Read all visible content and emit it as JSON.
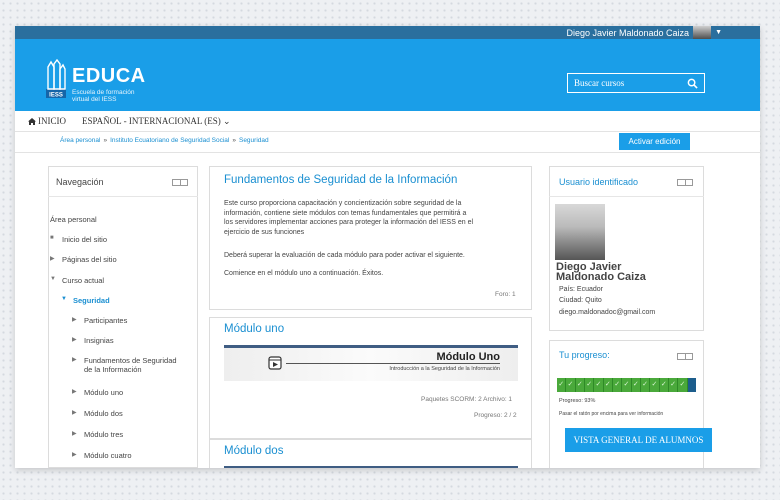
{
  "topbar": {
    "user_name": "Diego Javier Maldonado Caiza"
  },
  "header": {
    "logo_title": "EDUCA",
    "logo_subtitle_1": "Escuela de formación",
    "logo_subtitle_2": "virtual del IESS",
    "logo_mark_text": "IESS",
    "search_placeholder": "Buscar cursos"
  },
  "nav": {
    "home": "INICIO",
    "language": "ESPAÑOL - INTERNACIONAL (ES)"
  },
  "breadcrumb": [
    "Área personal",
    "Instituto Ecuatoriano de Seguridad Social",
    "Seguridad"
  ],
  "breadcrumb_separator": "»",
  "edit_button": "Activar edición",
  "navigation_block": {
    "title": "Navegación",
    "items": [
      "Área personal",
      "Inicio del sitio",
      "Páginas del sitio",
      "Curso actual",
      "Seguridad",
      "Participantes",
      "Insignias",
      "Fundamentos de Seguridad",
      "de la Información",
      "Módulo uno",
      "Módulo dos",
      "Módulo tres",
      "Módulo cuatro"
    ]
  },
  "course": {
    "title": "Fundamentos de Seguridad de la Información",
    "description_lines": [
      "Este curso proporciona capacitación y concientización sobre seguridad de la",
      "información, contiene siete módulos con temas fundamentales que permitirá a",
      "los servidores implementar acciones para proteger la información del IESS en el",
      "ejercicio de sus funciones"
    ],
    "instruction": "Deberá superar la evaluación de cada módulo para poder activar el siguiente.",
    "start_note": "Comience en el módulo uno a continuación. Éxitos.",
    "forum_link": "Foro: 1"
  },
  "module_one": {
    "title": "Módulo uno",
    "banner_title": "Módulo Uno",
    "banner_subtitle": "Introducción a la Seguridad de la Información",
    "meta": "Paquetes SCORM: 2  Archivo: 1",
    "progress": "Progreso: 2 / 2"
  },
  "module_two": {
    "title": "Módulo dos"
  },
  "user_block": {
    "title": "Usuario identificado",
    "name_line1": "Diego Javier",
    "name_line2": "Maldonado Caiza",
    "country": "País: Ecuador",
    "city": "Ciudad: Quito",
    "email": "diego.maldonadoc@gmail.com"
  },
  "progress_block": {
    "title": "Tu progreso:",
    "checks": [
      "✓",
      "✓",
      "✓",
      "✓",
      "✓",
      "✓",
      "✓",
      "✓",
      "✓",
      "✓",
      "✓",
      "✓",
      "✓",
      "✓",
      ""
    ],
    "progress_text": "Progreso: 93%",
    "progress_value": 93,
    "hover_hint": "Pasar el ratón por encima para ver información",
    "overview_button": "VISTA GENERAL DE ALUMNOS"
  },
  "colors": {
    "brand_blue": "#1a9ee8",
    "dark_bar": "#2a6f9e",
    "progress_green": "#4aa93b"
  }
}
